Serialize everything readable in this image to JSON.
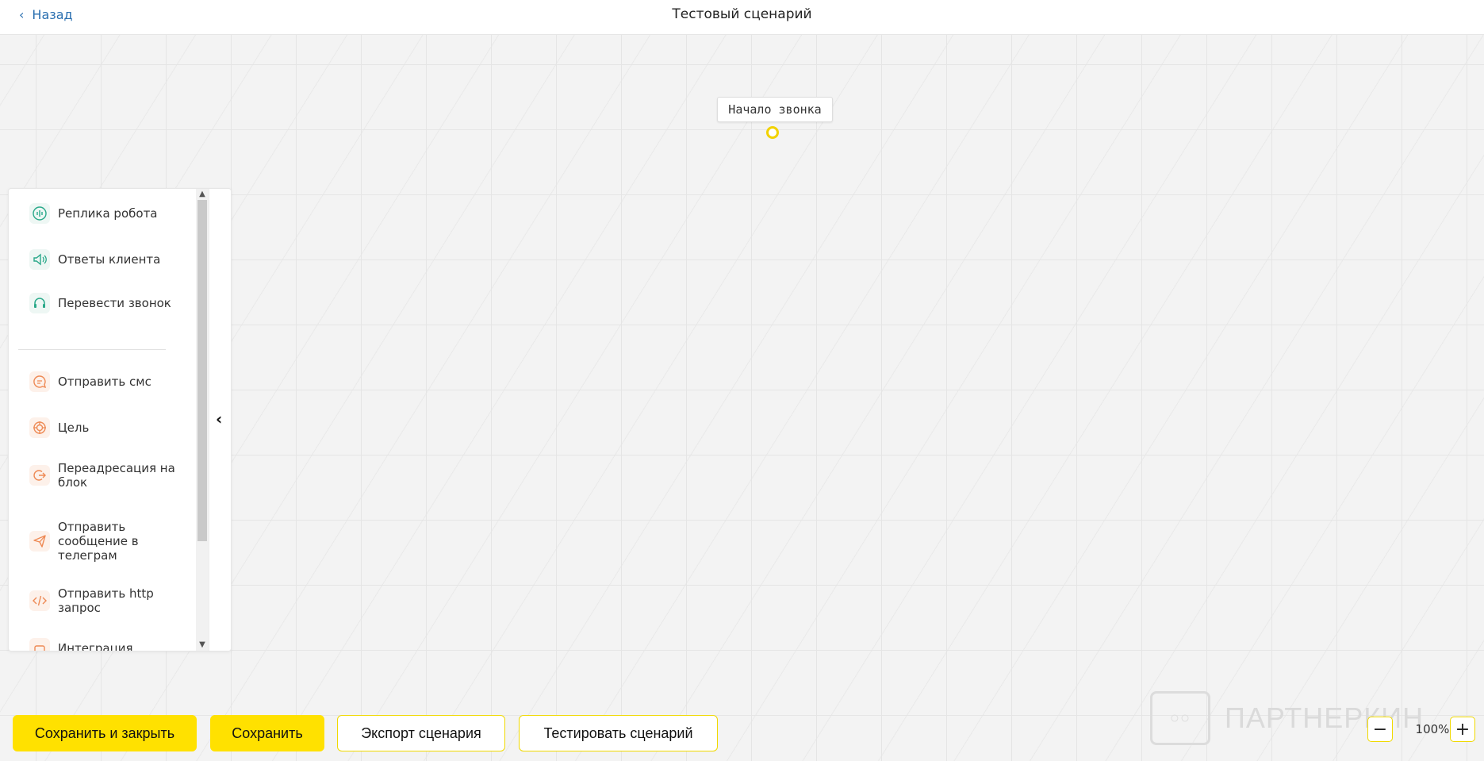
{
  "header": {
    "back_label": "Назад",
    "title": "Тестовый сценарий"
  },
  "canvas": {
    "start_node_label": "Начало звонка"
  },
  "palette": {
    "items": [
      {
        "label": "Реплика робота",
        "icon": "robot-voice-icon"
      },
      {
        "label": "Ответы клиента",
        "icon": "speaker-icon"
      },
      {
        "label": "Перевести звонок",
        "icon": "headset-icon"
      },
      {
        "label": "Отправить смс",
        "icon": "chat-bubble-icon"
      },
      {
        "label": "Цель",
        "icon": "target-icon"
      },
      {
        "label": "Переадресация на блок",
        "icon": "redirect-icon"
      },
      {
        "label": "Отправить сообщение в телеграм",
        "icon": "paper-plane-icon"
      },
      {
        "label": "Отправить http запрос",
        "icon": "code-icon"
      },
      {
        "label": "Интеграция",
        "icon": "integration-icon"
      }
    ],
    "colors": {
      "green": "#2aa98a",
      "orange": "#ee8a55"
    }
  },
  "footer": {
    "save_close_label": "Сохранить и закрыть",
    "save_label": "Сохранить",
    "export_label": "Экспорт сценария",
    "test_label": "Тестировать сценарий"
  },
  "zoom": {
    "value": "100%",
    "minus": "−",
    "plus": "+"
  },
  "watermark": {
    "text": "ПАРТНЕРКИН"
  },
  "accent_color": "#ffe100"
}
